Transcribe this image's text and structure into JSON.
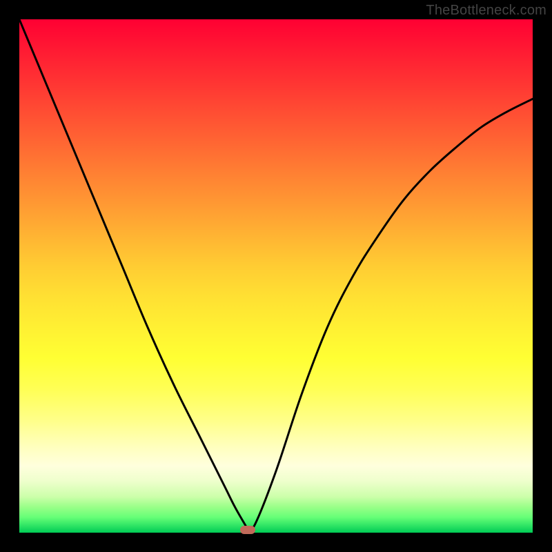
{
  "watermark": "TheBottleneck.com",
  "marker": {
    "x_frac": 0.445,
    "y_frac": 0.994
  },
  "chart_data": {
    "type": "line",
    "title": "",
    "xlabel": "",
    "ylabel": "",
    "xlim": [
      0,
      1
    ],
    "ylim": [
      0,
      1
    ],
    "series": [
      {
        "name": "bottleneck-curve",
        "x": [
          0.0,
          0.05,
          0.1,
          0.15,
          0.2,
          0.25,
          0.3,
          0.35,
          0.4,
          0.42,
          0.44,
          0.445,
          0.46,
          0.5,
          0.55,
          0.6,
          0.65,
          0.7,
          0.75,
          0.8,
          0.85,
          0.9,
          0.95,
          1.0
        ],
        "y": [
          1.0,
          0.88,
          0.76,
          0.64,
          0.52,
          0.4,
          0.29,
          0.19,
          0.09,
          0.05,
          0.015,
          0.006,
          0.018,
          0.12,
          0.27,
          0.4,
          0.5,
          0.58,
          0.65,
          0.705,
          0.75,
          0.79,
          0.82,
          0.845
        ]
      }
    ],
    "background_gradient": {
      "stops": [
        {
          "pos": 0.0,
          "color": "#ff0033"
        },
        {
          "pos": 0.5,
          "color": "#ffcc33"
        },
        {
          "pos": 0.8,
          "color": "#ffff88"
        },
        {
          "pos": 1.0,
          "color": "#00cc55"
        }
      ],
      "direction": "top-to-bottom"
    },
    "marker_point": {
      "x": 0.445,
      "y": 0.006,
      "color": "#c16a5a"
    }
  }
}
